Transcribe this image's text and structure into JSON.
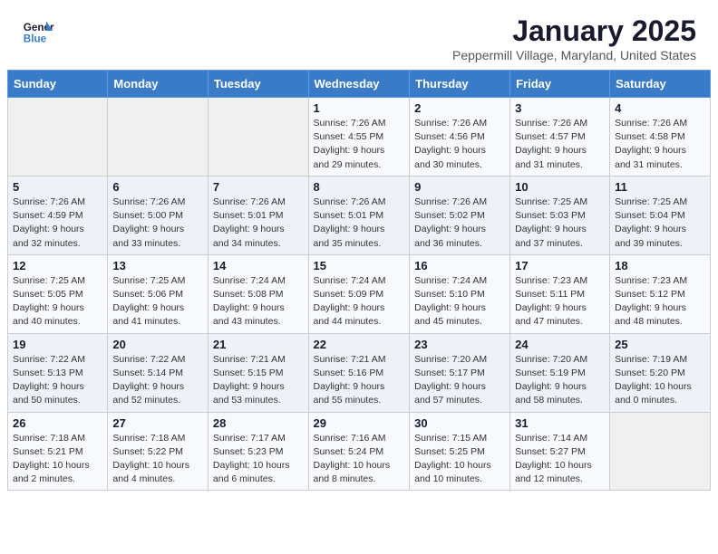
{
  "header": {
    "logo_line1": "General",
    "logo_line2": "Blue",
    "month": "January 2025",
    "location": "Peppermill Village, Maryland, United States"
  },
  "weekdays": [
    "Sunday",
    "Monday",
    "Tuesday",
    "Wednesday",
    "Thursday",
    "Friday",
    "Saturday"
  ],
  "weeks": [
    [
      {
        "day": "",
        "info": ""
      },
      {
        "day": "",
        "info": ""
      },
      {
        "day": "",
        "info": ""
      },
      {
        "day": "1",
        "info": "Sunrise: 7:26 AM\nSunset: 4:55 PM\nDaylight: 9 hours\nand 29 minutes."
      },
      {
        "day": "2",
        "info": "Sunrise: 7:26 AM\nSunset: 4:56 PM\nDaylight: 9 hours\nand 30 minutes."
      },
      {
        "day": "3",
        "info": "Sunrise: 7:26 AM\nSunset: 4:57 PM\nDaylight: 9 hours\nand 31 minutes."
      },
      {
        "day": "4",
        "info": "Sunrise: 7:26 AM\nSunset: 4:58 PM\nDaylight: 9 hours\nand 31 minutes."
      }
    ],
    [
      {
        "day": "5",
        "info": "Sunrise: 7:26 AM\nSunset: 4:59 PM\nDaylight: 9 hours\nand 32 minutes."
      },
      {
        "day": "6",
        "info": "Sunrise: 7:26 AM\nSunset: 5:00 PM\nDaylight: 9 hours\nand 33 minutes."
      },
      {
        "day": "7",
        "info": "Sunrise: 7:26 AM\nSunset: 5:01 PM\nDaylight: 9 hours\nand 34 minutes."
      },
      {
        "day": "8",
        "info": "Sunrise: 7:26 AM\nSunset: 5:01 PM\nDaylight: 9 hours\nand 35 minutes."
      },
      {
        "day": "9",
        "info": "Sunrise: 7:26 AM\nSunset: 5:02 PM\nDaylight: 9 hours\nand 36 minutes."
      },
      {
        "day": "10",
        "info": "Sunrise: 7:25 AM\nSunset: 5:03 PM\nDaylight: 9 hours\nand 37 minutes."
      },
      {
        "day": "11",
        "info": "Sunrise: 7:25 AM\nSunset: 5:04 PM\nDaylight: 9 hours\nand 39 minutes."
      }
    ],
    [
      {
        "day": "12",
        "info": "Sunrise: 7:25 AM\nSunset: 5:05 PM\nDaylight: 9 hours\nand 40 minutes."
      },
      {
        "day": "13",
        "info": "Sunrise: 7:25 AM\nSunset: 5:06 PM\nDaylight: 9 hours\nand 41 minutes."
      },
      {
        "day": "14",
        "info": "Sunrise: 7:24 AM\nSunset: 5:08 PM\nDaylight: 9 hours\nand 43 minutes."
      },
      {
        "day": "15",
        "info": "Sunrise: 7:24 AM\nSunset: 5:09 PM\nDaylight: 9 hours\nand 44 minutes."
      },
      {
        "day": "16",
        "info": "Sunrise: 7:24 AM\nSunset: 5:10 PM\nDaylight: 9 hours\nand 45 minutes."
      },
      {
        "day": "17",
        "info": "Sunrise: 7:23 AM\nSunset: 5:11 PM\nDaylight: 9 hours\nand 47 minutes."
      },
      {
        "day": "18",
        "info": "Sunrise: 7:23 AM\nSunset: 5:12 PM\nDaylight: 9 hours\nand 48 minutes."
      }
    ],
    [
      {
        "day": "19",
        "info": "Sunrise: 7:22 AM\nSunset: 5:13 PM\nDaylight: 9 hours\nand 50 minutes."
      },
      {
        "day": "20",
        "info": "Sunrise: 7:22 AM\nSunset: 5:14 PM\nDaylight: 9 hours\nand 52 minutes."
      },
      {
        "day": "21",
        "info": "Sunrise: 7:21 AM\nSunset: 5:15 PM\nDaylight: 9 hours\nand 53 minutes."
      },
      {
        "day": "22",
        "info": "Sunrise: 7:21 AM\nSunset: 5:16 PM\nDaylight: 9 hours\nand 55 minutes."
      },
      {
        "day": "23",
        "info": "Sunrise: 7:20 AM\nSunset: 5:17 PM\nDaylight: 9 hours\nand 57 minutes."
      },
      {
        "day": "24",
        "info": "Sunrise: 7:20 AM\nSunset: 5:19 PM\nDaylight: 9 hours\nand 58 minutes."
      },
      {
        "day": "25",
        "info": "Sunrise: 7:19 AM\nSunset: 5:20 PM\nDaylight: 10 hours\nand 0 minutes."
      }
    ],
    [
      {
        "day": "26",
        "info": "Sunrise: 7:18 AM\nSunset: 5:21 PM\nDaylight: 10 hours\nand 2 minutes."
      },
      {
        "day": "27",
        "info": "Sunrise: 7:18 AM\nSunset: 5:22 PM\nDaylight: 10 hours\nand 4 minutes."
      },
      {
        "day": "28",
        "info": "Sunrise: 7:17 AM\nSunset: 5:23 PM\nDaylight: 10 hours\nand 6 minutes."
      },
      {
        "day": "29",
        "info": "Sunrise: 7:16 AM\nSunset: 5:24 PM\nDaylight: 10 hours\nand 8 minutes."
      },
      {
        "day": "30",
        "info": "Sunrise: 7:15 AM\nSunset: 5:25 PM\nDaylight: 10 hours\nand 10 minutes."
      },
      {
        "day": "31",
        "info": "Sunrise: 7:14 AM\nSunset: 5:27 PM\nDaylight: 10 hours\nand 12 minutes."
      },
      {
        "day": "",
        "info": ""
      }
    ]
  ]
}
